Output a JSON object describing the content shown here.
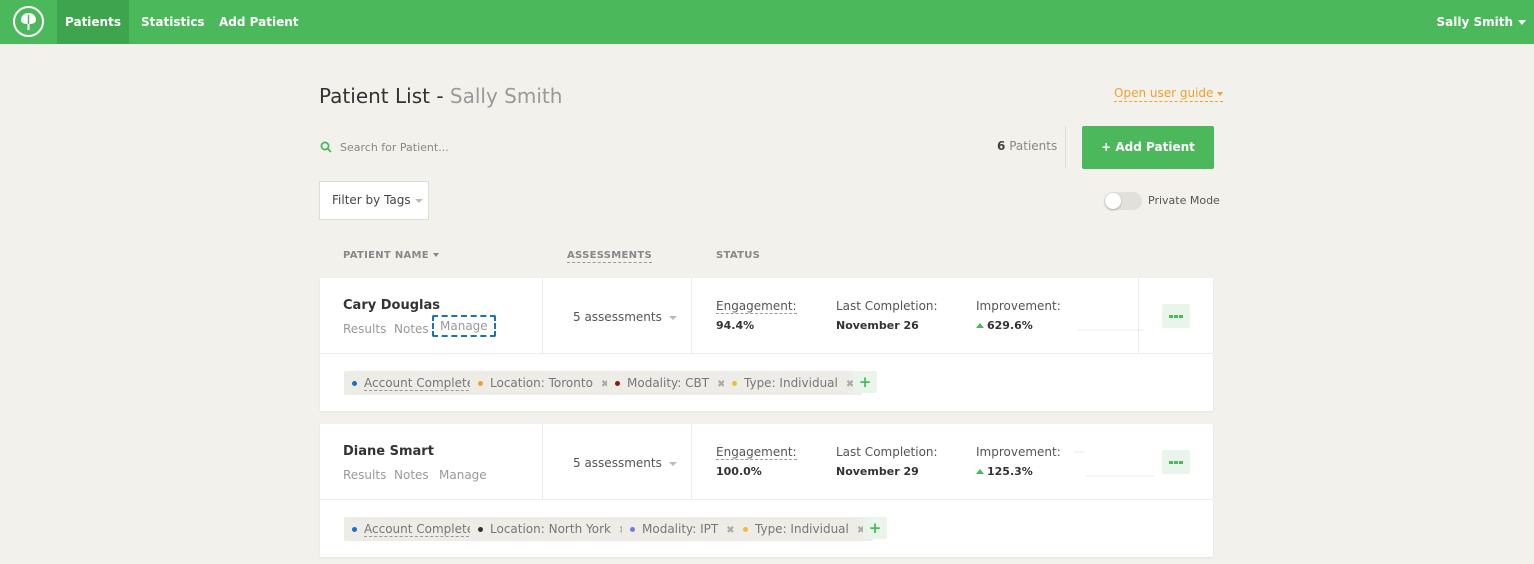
{
  "nav": {
    "items": [
      "Patients",
      "Statistics",
      "Add Patient"
    ],
    "user": "Sally Smith"
  },
  "header": {
    "title": "Patient List - ",
    "title_user": "Sally Smith",
    "guide_link": "Open user guide"
  },
  "search": {
    "placeholder": "Search for Patient..."
  },
  "count": {
    "number": "6",
    "label": "Patients"
  },
  "add_button": "+ Add Patient",
  "filter": {
    "label": "Filter by Tags"
  },
  "private_mode": {
    "label": "Private Mode",
    "on": false
  },
  "columns": [
    "PATIENT NAME",
    "ASSESSMENTS",
    "STATUS"
  ],
  "patients": [
    {
      "name": "Cary Douglas",
      "links": [
        "Results",
        "Notes",
        "Manage"
      ],
      "assessments": "5 assessments",
      "engagement_label": "Engagement:",
      "engagement": "94.4%",
      "last_label": "Last Completion:",
      "last": "November 26",
      "improvement_label": "Improvement:",
      "improvement": "629.6%",
      "tags": [
        {
          "text": "Account Complete",
          "color": "#1c6fc2",
          "removable": false
        },
        {
          "text": "Location: Toronto",
          "color": "#f0a030",
          "removable": true
        },
        {
          "text": "Modality: CBT",
          "color": "#8b1a1a",
          "removable": true
        },
        {
          "text": "Type: Individual",
          "color": "#e8c030",
          "removable": true
        }
      ]
    },
    {
      "name": "Diane Smart",
      "links": [
        "Results",
        "Notes",
        "Manage"
      ],
      "assessments": "5 assessments",
      "engagement_label": "Engagement:",
      "engagement": "100.0%",
      "last_label": "Last Completion:",
      "last": "November 29",
      "improvement_label": "Improvement:",
      "improvement": "125.3%",
      "tags": [
        {
          "text": "Account Complete",
          "color": "#1c6fc2",
          "removable": false
        },
        {
          "text": "Location: North York",
          "color": "#333333",
          "removable": true
        },
        {
          "text": "Modality: IPT",
          "color": "#6b7fe0",
          "removable": true
        },
        {
          "text": "Type: Individual",
          "color": "#e8c030",
          "removable": true
        }
      ]
    }
  ],
  "icons": {
    "logo": "leaf-logo-icon",
    "search": "search-icon",
    "more": "more-dots-icon",
    "remove": "close-icon",
    "add_tag": "plus-icon"
  }
}
